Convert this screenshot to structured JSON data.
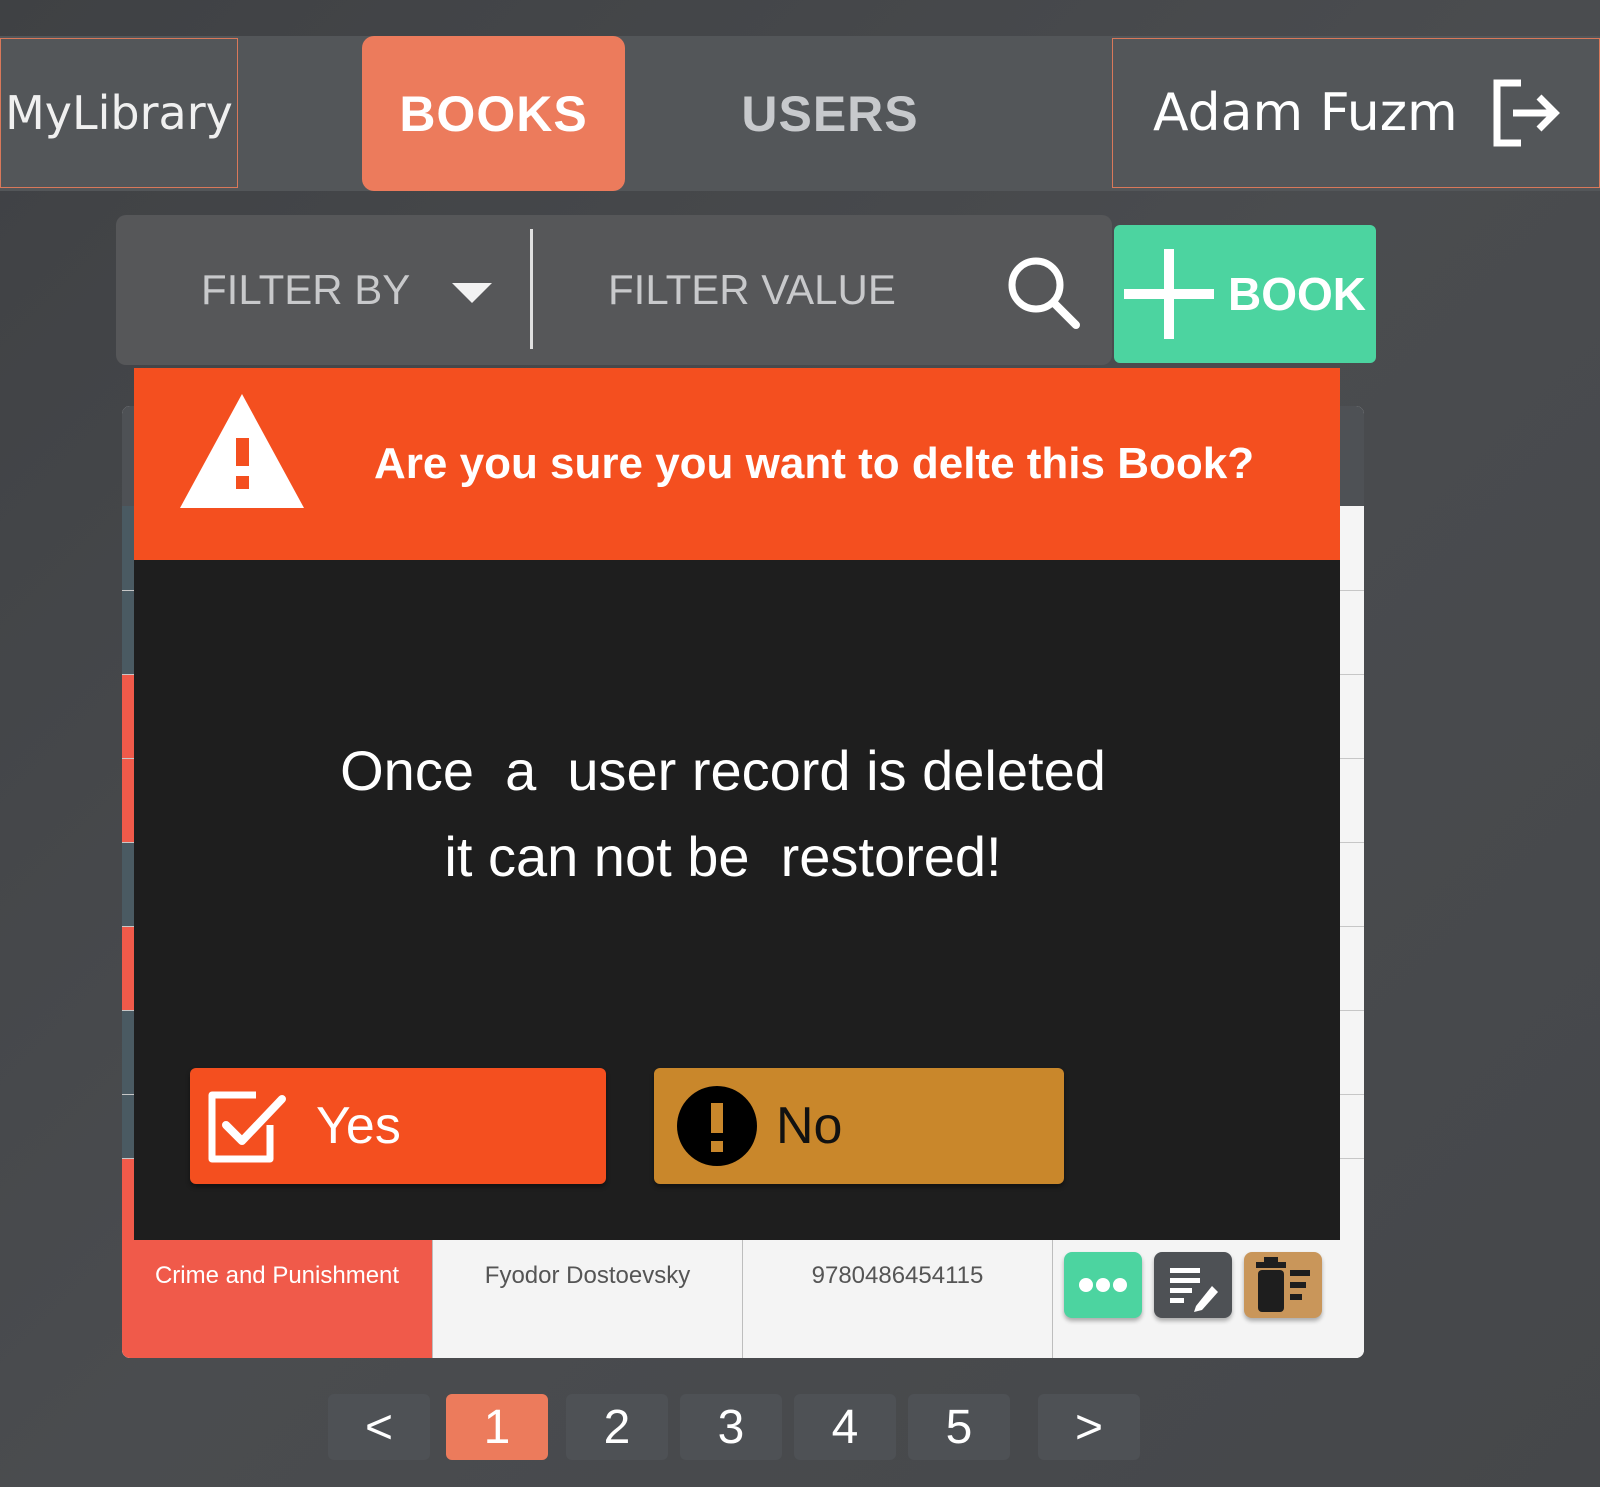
{
  "app": {
    "brand": "MyLibrary"
  },
  "nav": {
    "tabs": [
      {
        "label": "BOOKS",
        "active": true
      },
      {
        "label": "USERS",
        "active": false
      }
    ]
  },
  "user": {
    "name": "Adam Fuzm",
    "logout_icon": "logout-icon"
  },
  "filters": {
    "filter_by": "FILTER BY",
    "filter_value": "FILTER VALUE",
    "search_icon": "search-icon"
  },
  "add_button": {
    "label": "BOOK",
    "icon": "plus-icon"
  },
  "table": {
    "visible_row": {
      "title": "Crime and Punishment",
      "author": "Fyodor Dostoevsky",
      "isbn": "9780486454115"
    },
    "actions": [
      "more-icon",
      "edit-icon",
      "trash-icon"
    ]
  },
  "modal": {
    "title": "Are you sure you want to delte this Book?",
    "message": "Once  a  user record is deleted\nit can not be  restored!",
    "yes_label": "Yes",
    "no_label": "No"
  },
  "pagination": {
    "prev": "<",
    "pages": [
      "1",
      "2",
      "3",
      "4",
      "5"
    ],
    "current": "1",
    "next": ">"
  },
  "colors": {
    "accent": "#ec7b5c",
    "danger": "#f44f1f",
    "success": "#4cd4a0",
    "warning": "#c9872b"
  }
}
